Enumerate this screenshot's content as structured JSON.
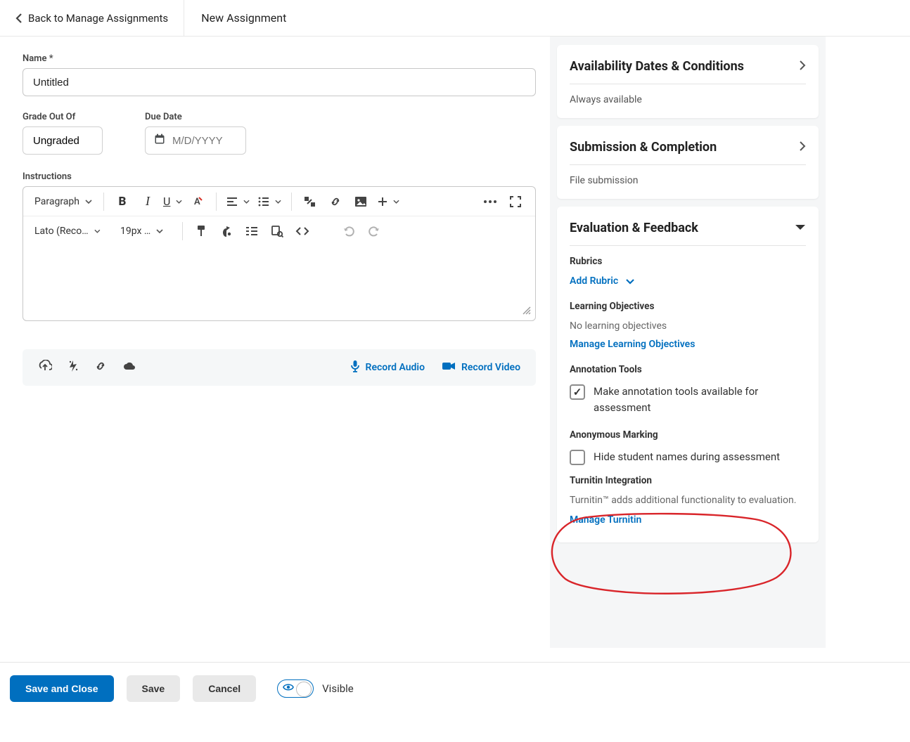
{
  "header": {
    "back_label": "Back to Manage Assignments",
    "page_title": "New Assignment"
  },
  "form": {
    "name_label": "Name *",
    "name_value": "Untitled",
    "grade_label": "Grade Out Of",
    "grade_value": "Ungraded",
    "due_label": "Due Date",
    "due_placeholder": "M/D/YYYY",
    "instructions_label": "Instructions"
  },
  "editor": {
    "format_dropdown": "Paragraph",
    "font_dropdown": "Lato (Recom…",
    "size_dropdown": "19px …"
  },
  "attach": {
    "record_audio": "Record Audio",
    "record_video": "Record Video"
  },
  "sidebar": {
    "availability": {
      "title": "Availability Dates & Conditions",
      "summary": "Always available"
    },
    "submission": {
      "title": "Submission & Completion",
      "summary": "File submission"
    },
    "evaluation": {
      "title": "Evaluation & Feedback",
      "rubrics_title": "Rubrics",
      "add_rubric": "Add Rubric",
      "lo_title": "Learning Objectives",
      "lo_none": "No learning objectives",
      "lo_manage": "Manage Learning Objectives",
      "ann_title": "Annotation Tools",
      "ann_label": "Make annotation tools available for assessment",
      "anon_title": "Anonymous Marking",
      "anon_label": "Hide student names during assessment",
      "turnitin_title": "Turnitin Integration",
      "turnitin_desc": "Turnitin™ adds additional functionality to evaluation.",
      "turnitin_link": "Manage Turnitin"
    }
  },
  "footer": {
    "save_close": "Save and Close",
    "save": "Save",
    "cancel": "Cancel",
    "visible": "Visible"
  }
}
